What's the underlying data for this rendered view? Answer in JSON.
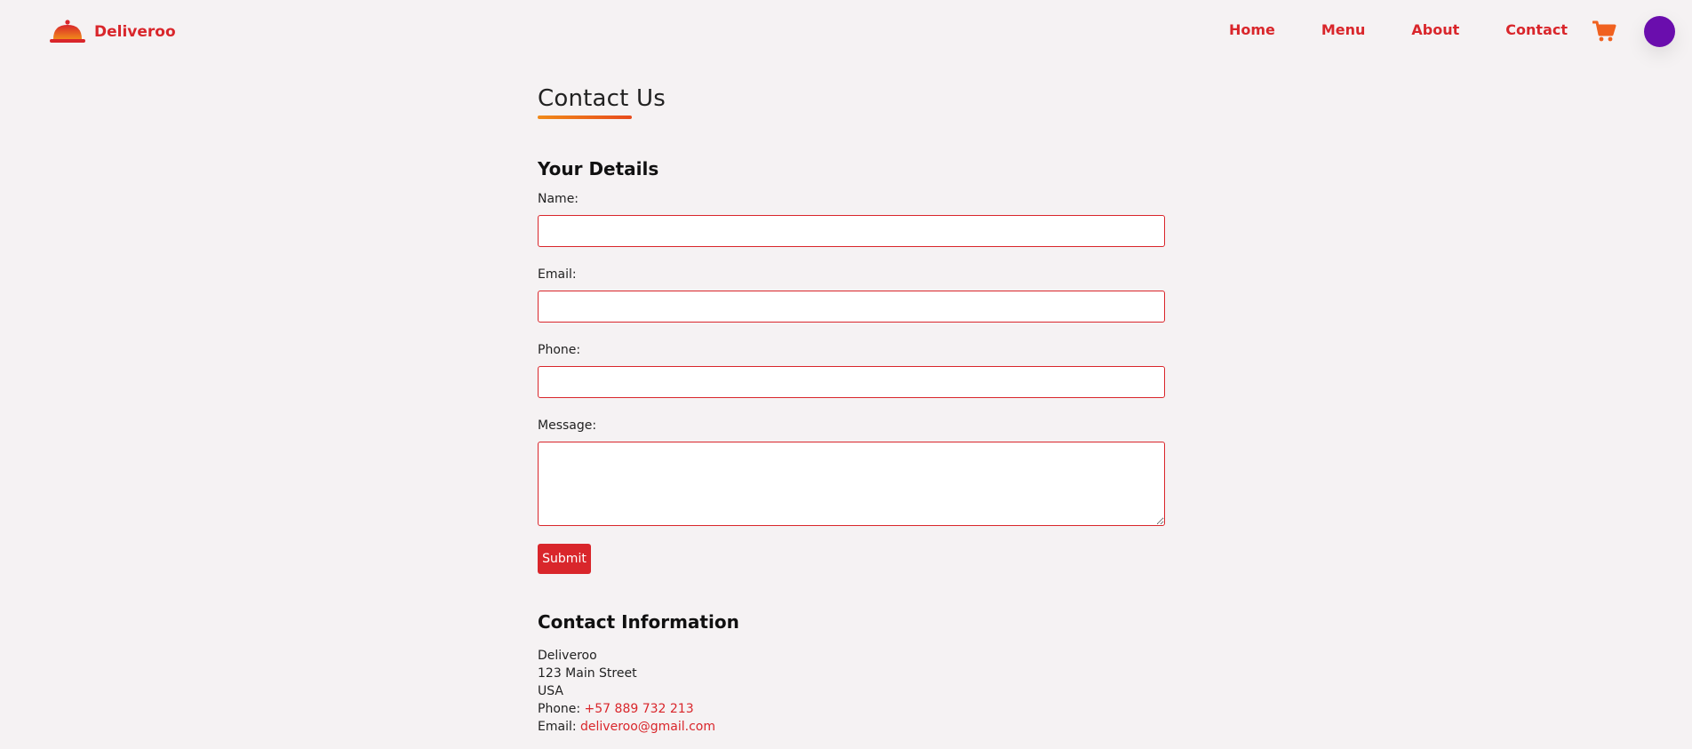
{
  "brand": {
    "name": "Deliveroo",
    "accent": "#d9262b",
    "avatar_color": "#6a0dad"
  },
  "nav": {
    "links": [
      {
        "label": "Home"
      },
      {
        "label": "Menu"
      },
      {
        "label": "About"
      },
      {
        "label": "Contact"
      }
    ],
    "cart_icon": "shopping-cart-icon"
  },
  "page": {
    "title": "Contact Us",
    "details_title": "Your Details",
    "form": {
      "name_label": "Name:",
      "email_label": "Email:",
      "phone_label": "Phone:",
      "message_label": "Message:",
      "name_value": "",
      "email_value": "",
      "phone_value": "",
      "message_value": "",
      "submit_label": "Submit"
    },
    "contact_info": {
      "title": "Contact Information",
      "company": "Deliveroo",
      "street": "123 Main Street",
      "country": "USA",
      "phone_label": "Phone:",
      "phone": "+57 889 732 213",
      "email_label": "Email:",
      "email": "deliveroo@gmail.com"
    }
  }
}
